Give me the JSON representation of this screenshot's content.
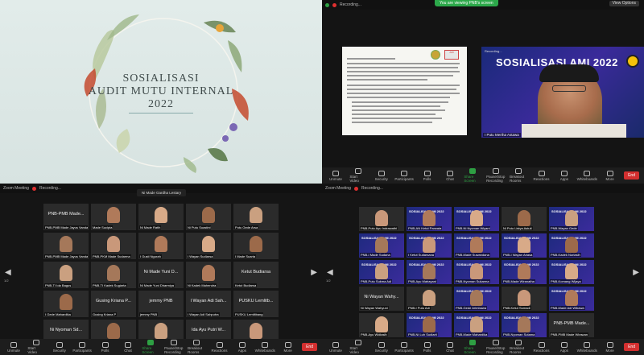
{
  "slide": {
    "title_line1": "SOSIALISASI",
    "title_line2": "AUDIT MUTU INTERNAL",
    "title_line3": "2022"
  },
  "topright": {
    "topbar_label": "Recording...",
    "share_banner": "You are viewing PNB's screen",
    "view_options": "View Options",
    "speaker_banner": "SOSIALISASI AMI 2022",
    "speaker_small": "Recording...",
    "speaker_name": "I Putu Mertha Astawa",
    "toolbar": [
      {
        "label": "Unmute",
        "green": false
      },
      {
        "label": "Start Video",
        "green": false
      },
      {
        "label": "Security",
        "green": false
      },
      {
        "label": "Participants",
        "green": false
      },
      {
        "label": "Polls",
        "green": false
      },
      {
        "label": "Chat",
        "green": false
      },
      {
        "label": "Share Screen",
        "green": true
      },
      {
        "label": "Pause/Stop Recording",
        "green": false
      },
      {
        "label": "Breakout Rooms",
        "green": false
      },
      {
        "label": "Reactions",
        "green": false
      },
      {
        "label": "Apps",
        "green": false
      },
      {
        "label": "Whiteboards",
        "green": false
      },
      {
        "label": "More",
        "green": false
      }
    ],
    "end_label": "End"
  },
  "bottomleft": {
    "topbar_label": "Zoom Meeting",
    "rec_label": "Recording...",
    "popup": "Ni Made Gardha Lestary",
    "page_left": "1/2",
    "tiles": [
      {
        "big": "PNB-PMB Made...",
        "name": "PNB-PMB Made Jayus Vanda"
      },
      {
        "big": "",
        "name": "Made Sucipta"
      },
      {
        "big": "",
        "name": "Ni Made Ratih"
      },
      {
        "big": "",
        "name": "Ni Putu Suastini"
      },
      {
        "big": "",
        "name": "Putu Gede Arsa"
      },
      {
        "big": "",
        "name": "PNB-PMB Made Jayus Vanda"
      },
      {
        "big": "",
        "name": "PNB-PKM Made Sudarma"
      },
      {
        "big": "",
        "name": "I Gusti Ngurah"
      },
      {
        "big": "",
        "name": "I Wayan Sudiarsa"
      },
      {
        "big": "",
        "name": "I Made Suarta"
      },
      {
        "big": "",
        "name": "PNB-TI Ida Bagus"
      },
      {
        "big": "",
        "name": "PNB-TI Kadek Sugiarta"
      },
      {
        "big": "Ni Made Yuni D...",
        "name": "Ni Made Yuni Dharmiya"
      },
      {
        "big": "",
        "name": "Ni Kadek Mahendra"
      },
      {
        "big": "Ketut Budiarsa",
        "name": "Ketut Budiarsa"
      },
      {
        "big": "",
        "name": "I Gede Mahardika"
      },
      {
        "big": "Gusing Kriana P...",
        "name": "Gusing Kriana P"
      },
      {
        "big": "jemmy PNB",
        "name": "jemmy PNB"
      },
      {
        "big": "I Wayan Adi Sah...",
        "name": "I Wayan Adi Sahputra"
      },
      {
        "big": "PUSKU Lemlitb...",
        "name": "PUSKU Lemlitbang"
      },
      {
        "big": "Ni Nyoman Sd...",
        "name": "Ni Nyoman Sudiasih"
      },
      {
        "big": "",
        "name": "Ni Luh Ayu Suryani"
      },
      {
        "big": "",
        "name": "Ni Putu Ayu Ardiani"
      },
      {
        "big": "Ida Ayu Putri W...",
        "name": "Ida Ayu Putri Wahyuni"
      },
      {
        "big": "",
        "name": "PNB-Made Santhyasa"
      }
    ]
  },
  "bottomright": {
    "topbar_label": "Zoom Meeting",
    "rec_label": "Recording...",
    "page_left": "1/2",
    "tiles": [
      {
        "big": "",
        "name": "PNB-Putu Ayu Indrawathi"
      },
      {
        "big": "",
        "name": "PNB-AN Ketut Parwata"
      },
      {
        "big": "",
        "name": "PNB-Ni Nyoman Wiyani"
      },
      {
        "big": "",
        "name": "Ni Putu Listya Astuti"
      },
      {
        "big": "",
        "name": "PNB-Wayan Gede"
      },
      {
        "big": "",
        "name": "PNB-I Made Sudana"
      },
      {
        "big": "",
        "name": "I Ketut Sudarsana"
      },
      {
        "big": "",
        "name": "PNB-Made Suwandana"
      },
      {
        "big": "",
        "name": "PNB-I Wayan Ariasa"
      },
      {
        "big": "",
        "name": "PNB-Kadek Nuriasih"
      },
      {
        "big": "",
        "name": "PNB-Putu Sukma Adi"
      },
      {
        "big": "",
        "name": "PNB-Ayu Mahayani"
      },
      {
        "big": "",
        "name": "PNB-Nyoman Sukarma"
      },
      {
        "big": "",
        "name": "PNB-Made Wiranatha"
      },
      {
        "big": "",
        "name": "PNB-Komang Wijaya"
      },
      {
        "big": "Ni Wayan Wahy...",
        "name": "Ni Wayan Wahyuni"
      },
      {
        "big": "",
        "name": "PNB-I Putu Adi"
      },
      {
        "big": "",
        "name": "PNB-Gede Arimbawa"
      },
      {
        "big": "",
        "name": "PNB-Ketut Sumadi"
      },
      {
        "big": "",
        "name": "PNB-Made Adi Wibawa"
      },
      {
        "big": "",
        "name": "PNB-Ayu Widiasih"
      },
      {
        "big": "",
        "name": "PNB-Ni Luh Sudiarti"
      },
      {
        "big": "",
        "name": "PNB-Made Mahardika"
      },
      {
        "big": "",
        "name": "PNB-Nyoman Sutama"
      },
      {
        "big": "PNB-PMB Made...",
        "name": "PNB-PMB Made Wirawan"
      }
    ]
  }
}
